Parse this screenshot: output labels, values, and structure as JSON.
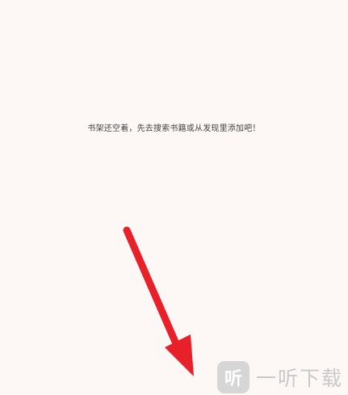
{
  "bookshelf": {
    "empty_message": "书架还空着，先去搜索书籍或从发现里添加吧！"
  },
  "annotation": {
    "arrow_color": "#e8202a"
  },
  "watermark": {
    "logo_char": "听",
    "text": "一听下载"
  }
}
